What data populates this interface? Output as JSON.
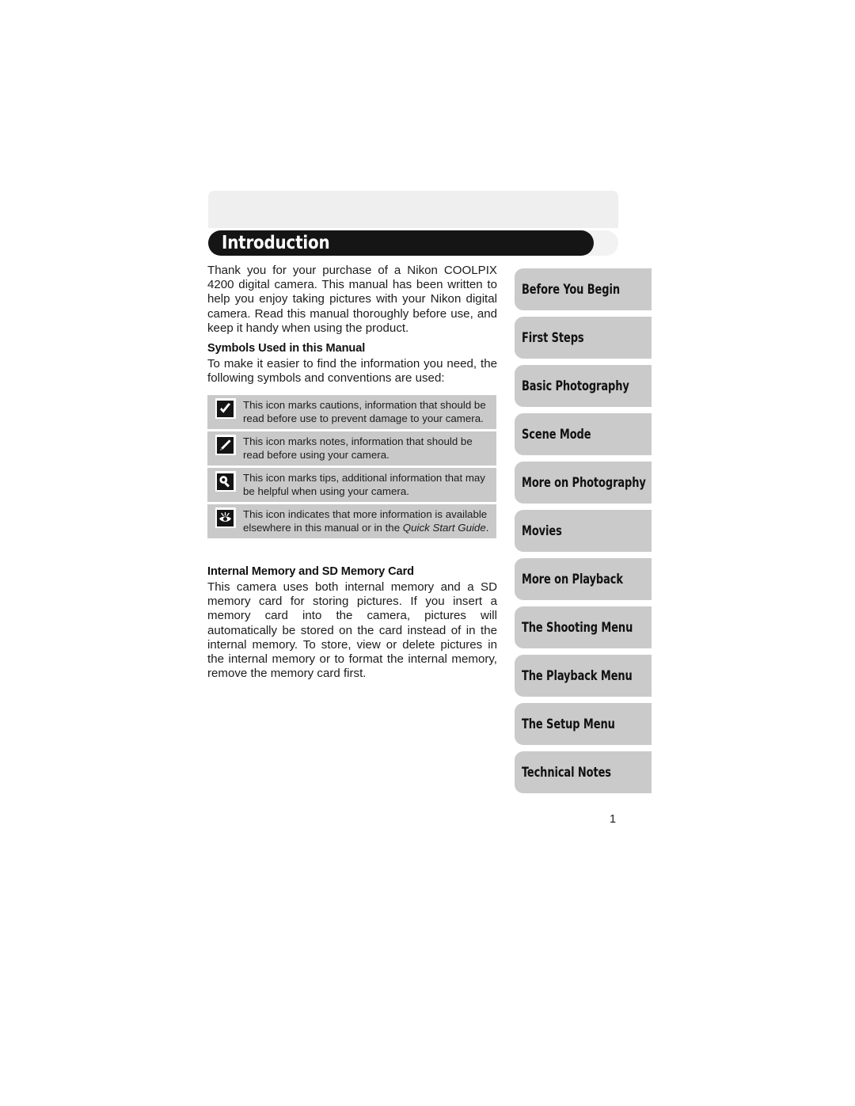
{
  "page": {
    "chapter_title": "Introduction",
    "page_number": "1",
    "colors": {
      "title_bar": "#151515",
      "title_backplate": "#f2f2f3",
      "top_band": "#efeff0",
      "tab_fill": "#cacaca",
      "table_row_fill": "#c9c9c9",
      "text": "#1c1c1c"
    }
  },
  "content": {
    "intro_paragraph": "Thank you for your purchase of a Nikon COOLPIX 4200 digital camera. This manual has been written to help you enjoy taking pictures with your Nikon digital camera. Read this manual thoroughly before use, and keep it handy when using the product.",
    "symbols_heading": "Symbols Used in this Manual",
    "symbols_intro": "To make it easier to find the information you need, the following symbols and conventions are used:",
    "memory_heading": "Internal Memory and SD Memory Card",
    "memory_paragraph": "This camera uses both internal memory and a SD memory card for storing pictures. If you insert a memory card into the camera, pictures will automatically be stored on the card instead of in the internal memory. To store, view or delete pictures in the internal memory or to format the internal memory, remove the memory card first."
  },
  "symbol_table": {
    "rows": [
      {
        "icon": "checkmark-caution-icon",
        "text": "This icon marks cautions, information that should be read before use to prevent damage to your camera."
      },
      {
        "icon": "pencil-note-icon",
        "text": "This icon marks notes, information that should be read before using your camera."
      },
      {
        "icon": "magnifier-tip-icon",
        "text": "This icon marks tips, additional information that may be helpful when using your camera."
      },
      {
        "icon": "eye-reference-icon",
        "text_before": "This icon indicates that more information is available elsewhere in this manual or in the ",
        "text_italic": "Quick Start Guide",
        "text_after": "."
      }
    ]
  },
  "tabs": [
    {
      "label": "Before You Begin"
    },
    {
      "label": "First Steps"
    },
    {
      "label": "Basic Photography"
    },
    {
      "label": "Scene Mode"
    },
    {
      "label": "More on Photography"
    },
    {
      "label": "Movies"
    },
    {
      "label": "More on Playback"
    },
    {
      "label": "The Shooting Menu"
    },
    {
      "label": "The Playback Menu"
    },
    {
      "label": "The Setup Menu"
    },
    {
      "label": "Technical Notes"
    }
  ]
}
